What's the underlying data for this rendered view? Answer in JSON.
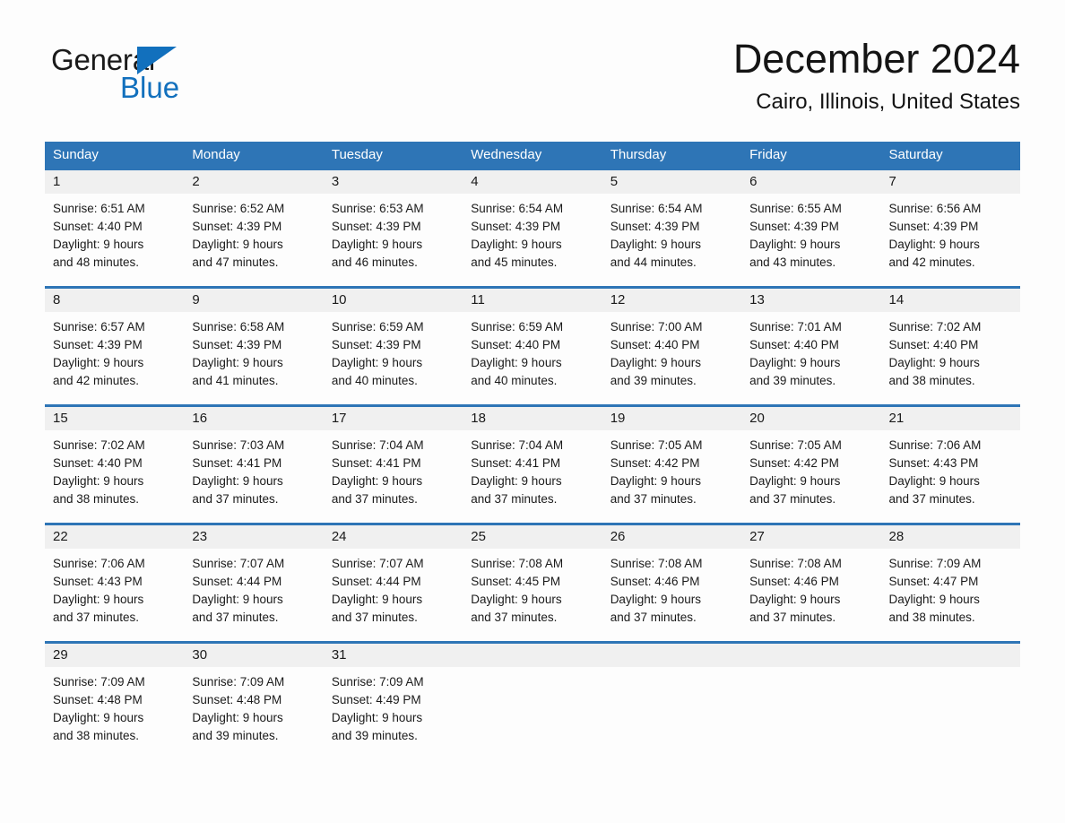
{
  "brand": {
    "name_part1": "General",
    "name_part2": "Blue",
    "accent_color": "#1270bd",
    "triangle_icon": "triangle-icon"
  },
  "header": {
    "month_title": "December 2024",
    "location": "Cairo, Illinois, United States"
  },
  "theme": {
    "header_blue": "#2e75b6",
    "day_strip_gray": "#f0f0f0",
    "page_background": "#fdfdfd",
    "text_color": "#1a1a1a"
  },
  "calendar": {
    "weekdays": [
      "Sunday",
      "Monday",
      "Tuesday",
      "Wednesday",
      "Thursday",
      "Friday",
      "Saturday"
    ],
    "weeks": [
      [
        {
          "date": "1",
          "sunrise": "Sunrise: 6:51 AM",
          "sunset": "Sunset: 4:40 PM",
          "daylight_line1": "Daylight: 9 hours",
          "daylight_line2": "and 48 minutes."
        },
        {
          "date": "2",
          "sunrise": "Sunrise: 6:52 AM",
          "sunset": "Sunset: 4:39 PM",
          "daylight_line1": "Daylight: 9 hours",
          "daylight_line2": "and 47 minutes."
        },
        {
          "date": "3",
          "sunrise": "Sunrise: 6:53 AM",
          "sunset": "Sunset: 4:39 PM",
          "daylight_line1": "Daylight: 9 hours",
          "daylight_line2": "and 46 minutes."
        },
        {
          "date": "4",
          "sunrise": "Sunrise: 6:54 AM",
          "sunset": "Sunset: 4:39 PM",
          "daylight_line1": "Daylight: 9 hours",
          "daylight_line2": "and 45 minutes."
        },
        {
          "date": "5",
          "sunrise": "Sunrise: 6:54 AM",
          "sunset": "Sunset: 4:39 PM",
          "daylight_line1": "Daylight: 9 hours",
          "daylight_line2": "and 44 minutes."
        },
        {
          "date": "6",
          "sunrise": "Sunrise: 6:55 AM",
          "sunset": "Sunset: 4:39 PM",
          "daylight_line1": "Daylight: 9 hours",
          "daylight_line2": "and 43 minutes."
        },
        {
          "date": "7",
          "sunrise": "Sunrise: 6:56 AM",
          "sunset": "Sunset: 4:39 PM",
          "daylight_line1": "Daylight: 9 hours",
          "daylight_line2": "and 42 minutes."
        }
      ],
      [
        {
          "date": "8",
          "sunrise": "Sunrise: 6:57 AM",
          "sunset": "Sunset: 4:39 PM",
          "daylight_line1": "Daylight: 9 hours",
          "daylight_line2": "and 42 minutes."
        },
        {
          "date": "9",
          "sunrise": "Sunrise: 6:58 AM",
          "sunset": "Sunset: 4:39 PM",
          "daylight_line1": "Daylight: 9 hours",
          "daylight_line2": "and 41 minutes."
        },
        {
          "date": "10",
          "sunrise": "Sunrise: 6:59 AM",
          "sunset": "Sunset: 4:39 PM",
          "daylight_line1": "Daylight: 9 hours",
          "daylight_line2": "and 40 minutes."
        },
        {
          "date": "11",
          "sunrise": "Sunrise: 6:59 AM",
          "sunset": "Sunset: 4:40 PM",
          "daylight_line1": "Daylight: 9 hours",
          "daylight_line2": "and 40 minutes."
        },
        {
          "date": "12",
          "sunrise": "Sunrise: 7:00 AM",
          "sunset": "Sunset: 4:40 PM",
          "daylight_line1": "Daylight: 9 hours",
          "daylight_line2": "and 39 minutes."
        },
        {
          "date": "13",
          "sunrise": "Sunrise: 7:01 AM",
          "sunset": "Sunset: 4:40 PM",
          "daylight_line1": "Daylight: 9 hours",
          "daylight_line2": "and 39 minutes."
        },
        {
          "date": "14",
          "sunrise": "Sunrise: 7:02 AM",
          "sunset": "Sunset: 4:40 PM",
          "daylight_line1": "Daylight: 9 hours",
          "daylight_line2": "and 38 minutes."
        }
      ],
      [
        {
          "date": "15",
          "sunrise": "Sunrise: 7:02 AM",
          "sunset": "Sunset: 4:40 PM",
          "daylight_line1": "Daylight: 9 hours",
          "daylight_line2": "and 38 minutes."
        },
        {
          "date": "16",
          "sunrise": "Sunrise: 7:03 AM",
          "sunset": "Sunset: 4:41 PM",
          "daylight_line1": "Daylight: 9 hours",
          "daylight_line2": "and 37 minutes."
        },
        {
          "date": "17",
          "sunrise": "Sunrise: 7:04 AM",
          "sunset": "Sunset: 4:41 PM",
          "daylight_line1": "Daylight: 9 hours",
          "daylight_line2": "and 37 minutes."
        },
        {
          "date": "18",
          "sunrise": "Sunrise: 7:04 AM",
          "sunset": "Sunset: 4:41 PM",
          "daylight_line1": "Daylight: 9 hours",
          "daylight_line2": "and 37 minutes."
        },
        {
          "date": "19",
          "sunrise": "Sunrise: 7:05 AM",
          "sunset": "Sunset: 4:42 PM",
          "daylight_line1": "Daylight: 9 hours",
          "daylight_line2": "and 37 minutes."
        },
        {
          "date": "20",
          "sunrise": "Sunrise: 7:05 AM",
          "sunset": "Sunset: 4:42 PM",
          "daylight_line1": "Daylight: 9 hours",
          "daylight_line2": "and 37 minutes."
        },
        {
          "date": "21",
          "sunrise": "Sunrise: 7:06 AM",
          "sunset": "Sunset: 4:43 PM",
          "daylight_line1": "Daylight: 9 hours",
          "daylight_line2": "and 37 minutes."
        }
      ],
      [
        {
          "date": "22",
          "sunrise": "Sunrise: 7:06 AM",
          "sunset": "Sunset: 4:43 PM",
          "daylight_line1": "Daylight: 9 hours",
          "daylight_line2": "and 37 minutes."
        },
        {
          "date": "23",
          "sunrise": "Sunrise: 7:07 AM",
          "sunset": "Sunset: 4:44 PM",
          "daylight_line1": "Daylight: 9 hours",
          "daylight_line2": "and 37 minutes."
        },
        {
          "date": "24",
          "sunrise": "Sunrise: 7:07 AM",
          "sunset": "Sunset: 4:44 PM",
          "daylight_line1": "Daylight: 9 hours",
          "daylight_line2": "and 37 minutes."
        },
        {
          "date": "25",
          "sunrise": "Sunrise: 7:08 AM",
          "sunset": "Sunset: 4:45 PM",
          "daylight_line1": "Daylight: 9 hours",
          "daylight_line2": "and 37 minutes."
        },
        {
          "date": "26",
          "sunrise": "Sunrise: 7:08 AM",
          "sunset": "Sunset: 4:46 PM",
          "daylight_line1": "Daylight: 9 hours",
          "daylight_line2": "and 37 minutes."
        },
        {
          "date": "27",
          "sunrise": "Sunrise: 7:08 AM",
          "sunset": "Sunset: 4:46 PM",
          "daylight_line1": "Daylight: 9 hours",
          "daylight_line2": "and 37 minutes."
        },
        {
          "date": "28",
          "sunrise": "Sunrise: 7:09 AM",
          "sunset": "Sunset: 4:47 PM",
          "daylight_line1": "Daylight: 9 hours",
          "daylight_line2": "and 38 minutes."
        }
      ],
      [
        {
          "date": "29",
          "sunrise": "Sunrise: 7:09 AM",
          "sunset": "Sunset: 4:48 PM",
          "daylight_line1": "Daylight: 9 hours",
          "daylight_line2": "and 38 minutes."
        },
        {
          "date": "30",
          "sunrise": "Sunrise: 7:09 AM",
          "sunset": "Sunset: 4:48 PM",
          "daylight_line1": "Daylight: 9 hours",
          "daylight_line2": "and 39 minutes."
        },
        {
          "date": "31",
          "sunrise": "Sunrise: 7:09 AM",
          "sunset": "Sunset: 4:49 PM",
          "daylight_line1": "Daylight: 9 hours",
          "daylight_line2": "and 39 minutes."
        },
        {
          "date": "",
          "sunrise": "",
          "sunset": "",
          "daylight_line1": "",
          "daylight_line2": ""
        },
        {
          "date": "",
          "sunrise": "",
          "sunset": "",
          "daylight_line1": "",
          "daylight_line2": ""
        },
        {
          "date": "",
          "sunrise": "",
          "sunset": "",
          "daylight_line1": "",
          "daylight_line2": ""
        },
        {
          "date": "",
          "sunrise": "",
          "sunset": "",
          "daylight_line1": "",
          "daylight_line2": ""
        }
      ]
    ]
  }
}
